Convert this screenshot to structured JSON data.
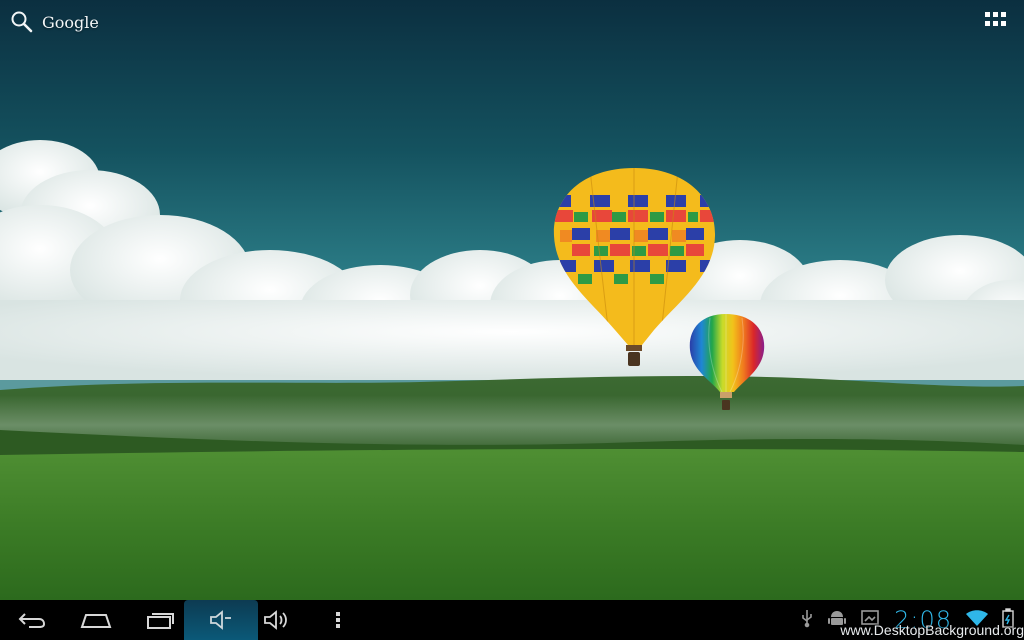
{
  "search_widget": {
    "label": "Google",
    "icon": "search-icon"
  },
  "apps_button": {
    "icon": "grid-icon"
  },
  "navbar": {
    "buttons": [
      {
        "name": "back-button",
        "icon": "back-arrow-icon"
      },
      {
        "name": "home-button",
        "icon": "home-icon"
      },
      {
        "name": "recent-apps-button",
        "icon": "recent-apps-icon"
      },
      {
        "name": "volume-down-button",
        "icon": "volume-down-icon"
      },
      {
        "name": "volume-up-button",
        "icon": "volume-up-icon"
      },
      {
        "name": "menu-button",
        "icon": "overflow-menu-icon"
      }
    ],
    "status_icons": [
      "usb-icon",
      "android-debug-icon",
      "screenshot-icon",
      "wifi-icon",
      "battery-icon"
    ],
    "clock": "2:08"
  },
  "watermark": "www.DesktopBackground.org",
  "colors": {
    "sky_top": "#0c3a4c",
    "sky_mid": "#1f6f7a",
    "grass": "#3f7d2a",
    "accent_blue": "#2fb7e8"
  }
}
